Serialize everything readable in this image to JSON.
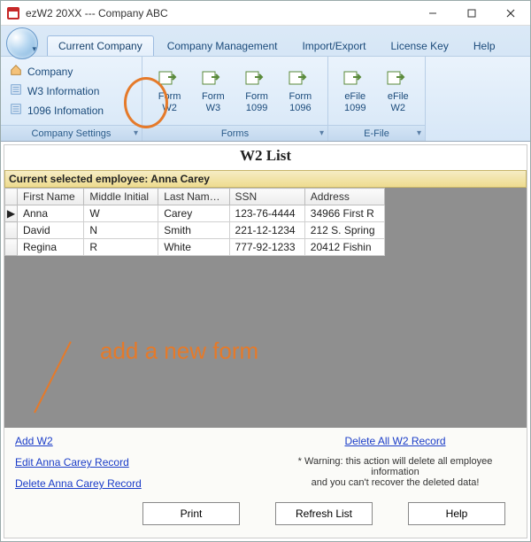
{
  "titlebar": {
    "title": "ezW2 20XX --- Company ABC"
  },
  "tabs": {
    "items": [
      "Current Company",
      "Company Management",
      "Import/Export",
      "License Key",
      "Help"
    ],
    "active_index": 0
  },
  "ribbon": {
    "settings_group_label": "Company Settings",
    "forms_group_label": "Forms",
    "efile_group_label": "E-File",
    "sidelist": [
      {
        "label": "Company",
        "icon": "home-icon"
      },
      {
        "label": "W3 Information",
        "icon": "form-icon"
      },
      {
        "label": "1096 Infomation",
        "icon": "form-icon"
      }
    ],
    "forms": [
      {
        "line1": "Form",
        "line2": "W2"
      },
      {
        "line1": "Form",
        "line2": "W3"
      },
      {
        "line1": "Form",
        "line2": "1099"
      },
      {
        "line1": "Form",
        "line2": "1096"
      }
    ],
    "efile": [
      {
        "line1": "eFile",
        "line2": "1099"
      },
      {
        "line1": "eFile",
        "line2": "W2"
      }
    ]
  },
  "list": {
    "title": "W2 List",
    "selected_label": "Current selected employee:  Anna Carey",
    "columns": [
      "First Name",
      "Middle Initial",
      "Last Nam…",
      "SSN",
      "Address"
    ],
    "rows": [
      {
        "first": "Anna",
        "mi": "W",
        "last": "Carey",
        "ssn": "123-76-4444",
        "addr": "34966 First R"
      },
      {
        "first": "David",
        "mi": "N",
        "last": "Smith",
        "ssn": "221-12-1234",
        "addr": "212 S. Spring"
      },
      {
        "first": "Regina",
        "mi": "R",
        "last": "White",
        "ssn": "777-92-1233",
        "addr": "20412 Fishin"
      }
    ]
  },
  "links": {
    "add": "Add W2",
    "edit": "Edit Anna Carey Record",
    "delete_one": "Delete Anna Carey Record",
    "delete_all": "Delete All W2 Record",
    "warning": "* Warning: this action will delete all employee information\nand you can't recover the deleted data!"
  },
  "buttons": {
    "print": "Print",
    "refresh": "Refresh List",
    "help": "Help"
  },
  "annotation": {
    "text": "add a new form"
  }
}
